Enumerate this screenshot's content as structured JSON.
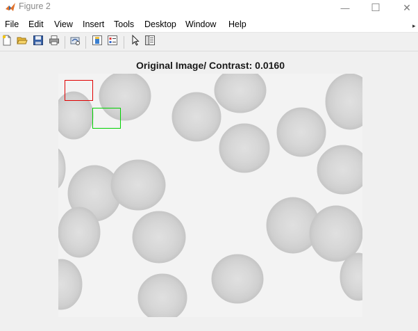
{
  "window": {
    "title": "Figure 2",
    "minimize_glyph": "—",
    "maximize_glyph": "☐",
    "close_glyph": "✕"
  },
  "menu": {
    "items": [
      "File",
      "Edit",
      "View",
      "Insert",
      "Tools",
      "Desktop",
      "Window",
      "Help"
    ]
  },
  "toolbar": {
    "buttons": [
      "new-figure-icon",
      "open-file-icon",
      "save-icon",
      "print-icon",
      "link-plot-icon",
      "colorbar-icon",
      "legend-icon",
      "edit-plot-pointer-icon",
      "property-inspector-icon"
    ]
  },
  "axes": {
    "title": "Original Image/ Contrast: 0.0160"
  },
  "roi": {
    "colors": {
      "red": "#e00000",
      "green": "#00d000"
    }
  },
  "colors": {
    "background": "#f0f0f0",
    "cell_fill": "#d9d9d9",
    "cell_edge": "#c9c9c9",
    "plasma": "#f4f4f4"
  }
}
